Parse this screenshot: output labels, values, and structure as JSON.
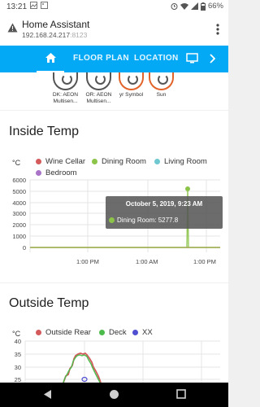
{
  "status_bar": {
    "time": "13:21",
    "battery": "66%",
    "icons": [
      "photo-icon",
      "alarm-icon",
      "wifi-icon",
      "signal-icon",
      "battery-icon"
    ]
  },
  "browser": {
    "title": "Home Assistant",
    "url_host": "192.168.24.217",
    "url_port": ":8123"
  },
  "nav": {
    "tabs": [
      {
        "label": "FLOOR PLAN"
      },
      {
        "label": "LOCATION"
      }
    ],
    "accent_color": "#03a9f4"
  },
  "entities": [
    {
      "label_line1": "DK: AEON",
      "label_line2": "Multisen...",
      "ring_color": "#555555"
    },
    {
      "label_line1": "OR: AEON",
      "label_line2": "Multisen...",
      "ring_color": "#555555"
    },
    {
      "label_line1": "yr Symbol",
      "label_line2": "",
      "ring_color": "#e2632a"
    },
    {
      "label_line1": "Sun",
      "label_line2": "",
      "ring_color": "#e2632a"
    }
  ],
  "inside_temp": {
    "title": "Inside Temp",
    "unit": "°C",
    "legend": [
      {
        "name": "Wine Cellar",
        "color": "#d35b5b"
      },
      {
        "name": "Dining Room",
        "color": "#8cc44a"
      },
      {
        "name": "Living Room",
        "color": "#6fc8d0"
      },
      {
        "name": "Bedroom",
        "color": "#a974c8"
      }
    ],
    "tooltip": {
      "title": "October 5, 2019, 9:23 AM",
      "body": "Dining Room: 5277.8"
    }
  },
  "outside_temp": {
    "title": "Outside Temp",
    "unit": "°C",
    "legend": [
      {
        "name": "Outside Rear",
        "color": "#d35b5b"
      },
      {
        "name": "Deck",
        "color": "#4cbb4c"
      },
      {
        "name": "XX",
        "color": "#4f4fd0"
      }
    ]
  },
  "chart_data": [
    {
      "type": "line",
      "title": "Inside Temp",
      "ylabel": "°C",
      "ylim": [
        0,
        6000
      ],
      "y_ticks": [
        "6000",
        "5000",
        "4000",
        "3000",
        "2000",
        "1000",
        "0"
      ],
      "x_ticks": [
        "1:00 PM",
        "1:00 AM",
        "1:00 PM"
      ],
      "grid": true,
      "legend_position": "top",
      "series": [
        {
          "name": "Wine Cellar",
          "values": [
            0,
            0,
            0,
            0
          ]
        },
        {
          "name": "Dining Room",
          "values": [
            0,
            0,
            5277.8,
            0
          ]
        },
        {
          "name": "Living Room",
          "values": []
        },
        {
          "name": "Bedroom",
          "values": []
        }
      ]
    },
    {
      "type": "line",
      "title": "Outside Temp",
      "ylabel": "°C",
      "ylim": [
        25,
        40
      ],
      "y_ticks": [
        "40",
        "35",
        "30",
        "25"
      ],
      "grid": true,
      "legend_position": "top",
      "series": [
        {
          "name": "Outside Rear",
          "values": [
            25,
            28,
            32,
            35,
            35.5,
            35,
            33,
            30,
            27,
            25
          ]
        },
        {
          "name": "Deck",
          "values": [
            25,
            27.5,
            31.5,
            34.5,
            35,
            34.5,
            32.5,
            29.5,
            26.5,
            24.5
          ]
        },
        {
          "name": "XX",
          "values": [
            26
          ]
        }
      ]
    }
  ]
}
